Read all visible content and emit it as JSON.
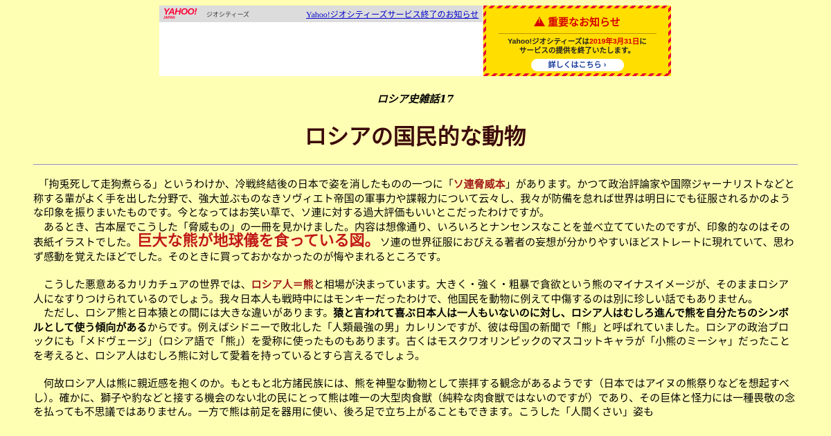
{
  "banner": {
    "yahoo_logo": "YAHOO!",
    "yahoo_logo_sub": "JAPAN",
    "geo_label": "ジオシティーズ",
    "end_notice_link": "Yahoo!ジオシティーズサービス終了のお知らせ",
    "notice_title": "重要なお知らせ",
    "notice_line1_pre": "Yahoo!ジオシティーズは",
    "notice_date": "2019年3月31日",
    "notice_line1_post": "に",
    "notice_line2": "サービスの提供を終了いたします。",
    "details_button": "詳しくはこちら ›"
  },
  "article": {
    "series": "ロシア史雑話17",
    "title": "ロシアの国民的な動物",
    "p1": {
      "a": "「拘兎死して走狗煮らる」というわけか、冷戦終結後の日本で姿を消したものの一つに「",
      "em": "ソ連脅威本",
      "b": "」があります。かつて政治評論家や国際ジャーナリストなどと称する輩がよく手を出した分野で、強大並ぶものなきソヴィエト帝国の軍事力や諜報力について云々し、我々が防備を怠れば世界は明日にでも征服されるかのような印象を振りまいたものです。今となってはお笑い草で、ソ連に対する過大評価もいいとこだったわけですが。",
      "c": "あるとき、古本屋でこうした「脅威もの」の一冊を見かけました。内容は想像通り、いろいろとナンセンスなことを並べ立てていたのですが、印象的なのはその表紙イラストでした。",
      "big": "巨大な熊が地球儀を食っている図。",
      "d": "ソ連の世界征服におびえる著者の妄想が分かりやすいほどストレートに現れていて、思わず感動を覚えたほどでした。そのときに買っておかなかったのが悔やまれるところです。"
    },
    "p2": {
      "a": "こうした悪意あるカリカチュアの世界では、",
      "em": "ロシア人＝熊",
      "b": "と相場が決まっています。大きく・強く・粗暴で貪欲という熊のマイナスイメージが、そのままロシア人になすりつけられているのでしょう。我々日本人も戦時中にはモンキーだったわけで、他国民を動物に例えて中傷するのは別に珍しい話でもありません。",
      "c": "ただし、ロシア熊と日本猿との間には大きな違いがあります。",
      "strong": "猿と言われて喜ぶ日本人は一人もいないのに対し、ロシア人はむしろ進んで熊を自分たちのシンボルとして使う傾向がある",
      "d": "からです。例えばシドニーで敗北した「人類最強の男」カレリンですが、彼は母国の新聞で「熊」と呼ばれていました。ロシアの政治ブロックにも「メドヴェージ」（ロシア語で「熊」）を愛称に使ったものもあります。古くはモスクワオリンピックのマスコットキャラが「小熊のミーシャ」だったことを考えると、ロシア人はむしろ熊に対して愛着を持っているとすら言えるでしょう。"
    },
    "p3": {
      "a": "何故ロシア人は熊に親近感を抱くのか。もともと北方諸民族には、熊を神聖な動物として崇拝する観念があるようです（日本ではアイヌの熊祭りなどを想起すべし）。確かに、獅子や豹などと接する機会のない北の民にとって熊は唯一の大型肉食獣（純粋な肉食獣ではないのですが）であり、その巨体と怪力には一種畏敬の念を払っても不思議ではありません。一方で熊は前足を器用に使い、後ろ足で立ち上がることもできます。こうした「人間くさい」姿も"
    }
  }
}
